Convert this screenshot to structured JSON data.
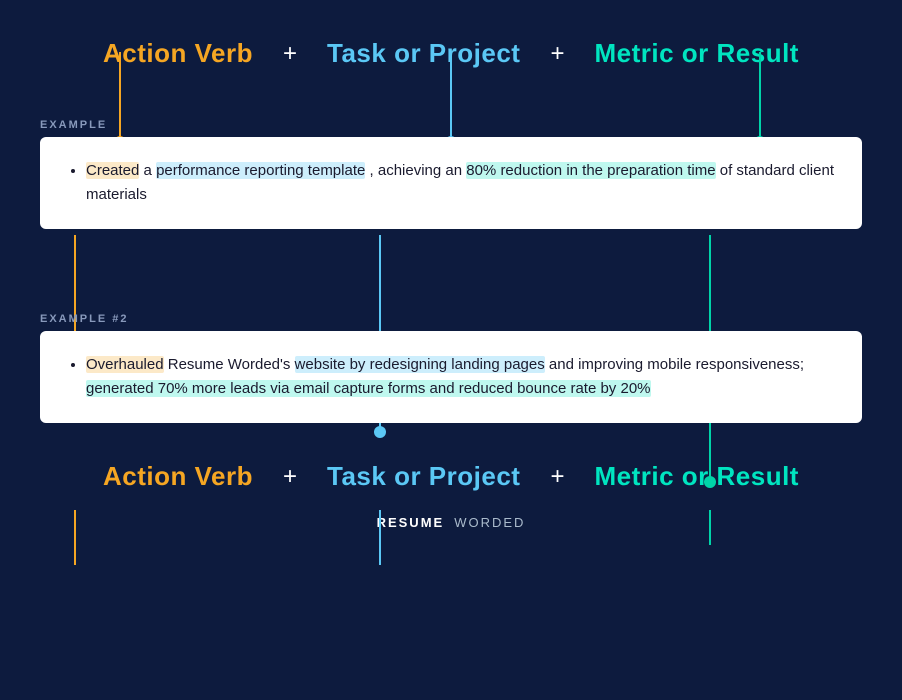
{
  "header": {
    "action_verb": "Action Verb",
    "task_or_project": "Task or Project",
    "metric_or_result": "Metric or Result",
    "plus": "+"
  },
  "example1": {
    "label": "EXAMPLE",
    "bullet": {
      "action_verb_text": "Created",
      "rest_text": " a ",
      "task_text": "performance reporting template",
      "middle_text": ", achieving an ",
      "metric_text": "80% reduction in the preparation time",
      "end_text": " of standard client materials"
    }
  },
  "example2": {
    "label": "EXAMPLE #2",
    "bullet": {
      "action_verb_text": "Overhauled",
      "rest1": " Resume Worded's ",
      "task_text": "website by redesigning landing pages",
      "middle": " and improving mobile responsiveness; ",
      "metric_text": "generated 70% more leads via email capture forms and reduced bounce rate by 20%",
      "end": ""
    }
  },
  "footer": {
    "brand1": "RESUME",
    "brand2": "WORDED"
  },
  "colors": {
    "orange": "#f5a623",
    "blue": "#5bc8f5",
    "teal": "#00d4a8",
    "background": "#0d1b3e"
  }
}
